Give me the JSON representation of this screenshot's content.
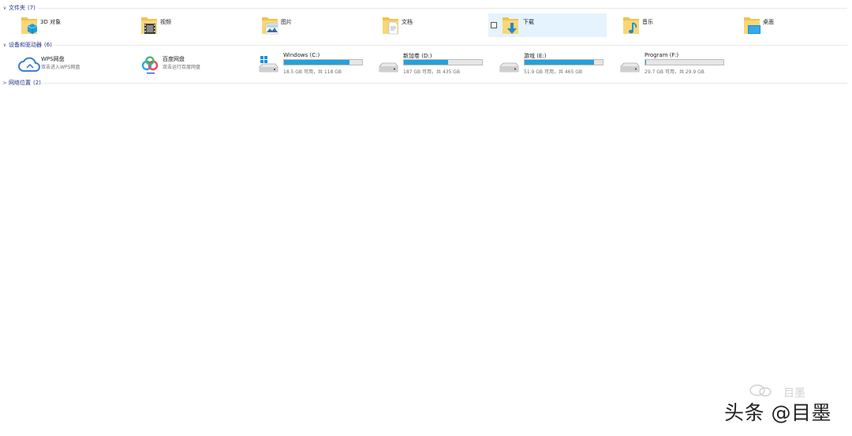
{
  "groups": {
    "folders": {
      "label": "文件夹",
      "count": "(7)"
    },
    "devices": {
      "label": "设备和驱动器",
      "count": "(6)"
    },
    "network": {
      "label": "网络位置",
      "count": "(2)"
    }
  },
  "folders": [
    {
      "label": "3D 对象",
      "icon": "3d-objects-folder-icon"
    },
    {
      "label": "视频",
      "icon": "videos-folder-icon"
    },
    {
      "label": "图片",
      "icon": "pictures-folder-icon"
    },
    {
      "label": "文档",
      "icon": "documents-folder-icon"
    },
    {
      "label": "下载",
      "icon": "downloads-folder-icon",
      "selected": true
    },
    {
      "label": "音乐",
      "icon": "music-folder-icon"
    },
    {
      "label": "桌面",
      "icon": "desktop-folder-icon"
    }
  ],
  "net_locations": [
    {
      "name": "WPS网盘",
      "desc": "双击进入WPS网盘",
      "icon": "wps-cloud-icon"
    },
    {
      "name": "百度网盘",
      "desc": "双击运行百度网盘",
      "icon": "baidu-netdisk-icon"
    }
  ],
  "drives": [
    {
      "name": "Windows (C:)",
      "free": "18.5 GB 可用，共 118 GB",
      "used_fraction": 0.84,
      "icon": "windows-drive-icon"
    },
    {
      "name": "新加卷 (D:)",
      "free": "187 GB 可用，共 435 GB",
      "used_fraction": 0.57,
      "icon": "hard-drive-icon"
    },
    {
      "name": "游戏 (E:)",
      "free": "51.9 GB 可用，共 465 GB",
      "used_fraction": 0.89,
      "icon": "hard-drive-icon"
    },
    {
      "name": "Program (F:)",
      "free": "29.7 GB 可用，共 29.9 GB",
      "used_fraction": 0.01,
      "icon": "hard-drive-icon"
    }
  ],
  "watermark": {
    "text": "头条 @目墨",
    "ghost_text": "目墨"
  },
  "colors": {
    "bar_fill": "#26a0da",
    "selection": "#e5f3ff",
    "folder": "#f4c95d",
    "header_text": "#1e3287"
  }
}
